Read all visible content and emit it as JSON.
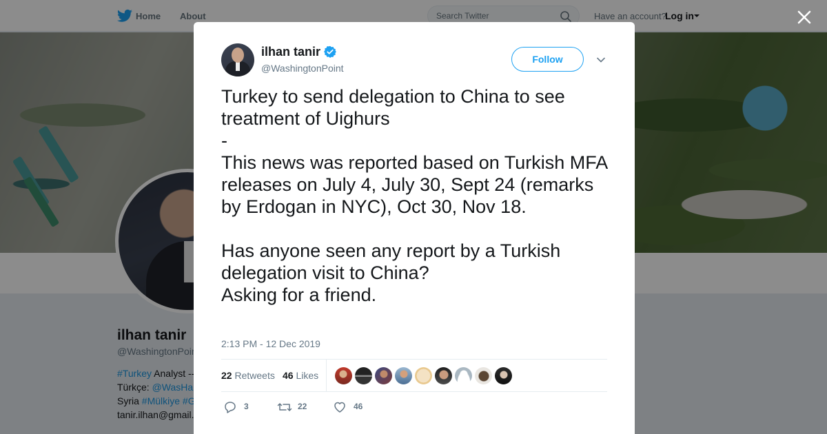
{
  "nav": {
    "home_label": "Home",
    "about_label": "About",
    "search_placeholder": "Search Twitter",
    "account_text": "Have an account?",
    "login_label": "Log in"
  },
  "profile": {
    "name": "ilhan tanir",
    "handle": "@WashingtonPoint",
    "bio_line1_tag": "#Turkey",
    "bio_line1_rest": " Analyst --",
    "bio_line2_prefix": "Türkçe: ",
    "bio_line2_mention": "@WasHa",
    "bio_line3_prefix": "Syria ",
    "bio_line3_tags": "#Mülkiye #G",
    "bio_line4": "tanir.ilhan@gmail."
  },
  "tweet": {
    "author_name": "ilhan tanir",
    "author_handle": "@WashingtonPoint",
    "follow_label": "Follow",
    "text": "Turkey to send delegation to China to see treatment of Uighurs\n-\nThis news was reported based on Turkish MFA releases on July 4, July 30, Sept 24 (remarks by Erdogan in NYC), Oct 30, Nov 18.\n\nHas anyone seen any report by a Turkish delegation visit to China?\nAsking for a friend.",
    "timestamp": "2:13 PM - 12 Dec 2019",
    "retweets_count": "22",
    "retweets_label": "Retweets",
    "likes_count": "46",
    "likes_label": "Likes",
    "reply_count": "3",
    "retweet_action_count": "22",
    "like_action_count": "46"
  },
  "colors": {
    "accent": "#1da1f2",
    "link": "#1b95e0",
    "text": "#14171a",
    "secondary": "#657786"
  },
  "icons": [
    "twitter-bird-icon",
    "search-icon",
    "close-icon",
    "verified-badge-icon",
    "chevron-down-icon",
    "reply-icon",
    "retweet-icon",
    "like-icon"
  ]
}
